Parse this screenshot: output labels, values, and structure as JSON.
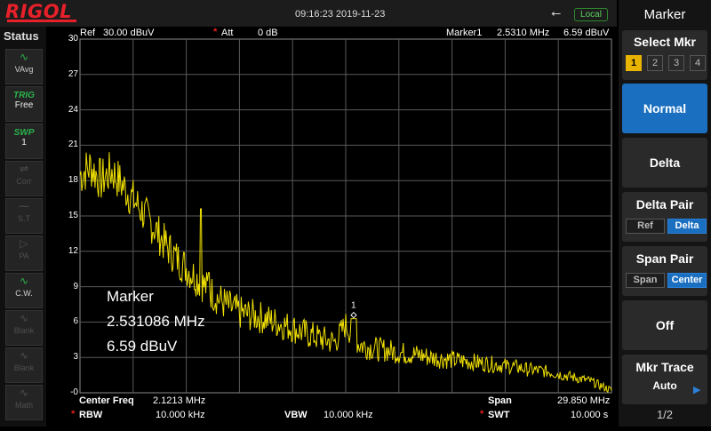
{
  "top": {
    "brand": "RIGOL",
    "datetime": "09:16:23 2019-11-23",
    "local_badge": "Local",
    "usb_icon": "usb-icon"
  },
  "status": {
    "title": "Status",
    "items": [
      {
        "name": "trace-avg",
        "icon": "wave-icon",
        "label": "VAvg",
        "state": "active"
      },
      {
        "name": "trig",
        "line1": "TRIG",
        "line2": "Free",
        "state": "text"
      },
      {
        "name": "swp",
        "line1": "SWP",
        "line2": "1",
        "state": "text"
      },
      {
        "name": "corr",
        "icon": "corr-icon",
        "label": "Corr",
        "state": "dim"
      },
      {
        "name": "st",
        "icon": "st-icon",
        "label": "S.T",
        "state": "dim"
      },
      {
        "name": "pa",
        "icon": "pa-icon",
        "label": "PA",
        "state": "dim"
      },
      {
        "name": "cw",
        "icon": "cw-icon",
        "label": "C.W.",
        "state": "active"
      },
      {
        "name": "blank1",
        "icon": "blank-icon",
        "label": "Blank",
        "state": "dim"
      },
      {
        "name": "blank2",
        "icon": "blank-icon",
        "label": "Blank",
        "state": "dim"
      },
      {
        "name": "math",
        "icon": "math-icon",
        "label": "Math",
        "state": "dim"
      }
    ]
  },
  "header": {
    "ref_label": "Ref",
    "ref_value": "30.00 dBuV",
    "att_label": "Att",
    "att_value": "0 dB",
    "marker_label": "Marker1",
    "marker_freq": "2.5310 MHz",
    "marker_level": "6.59 dBuV"
  },
  "footer": {
    "center_label": "Center Freq",
    "center_value": "2.1213 MHz",
    "span_label": "Span",
    "span_value": "29.850 MHz",
    "rbw_label": "RBW",
    "rbw_value": "10.000 kHz",
    "vbw_label": "VBW",
    "vbw_value": "10.000 kHz",
    "swt_label": "SWT",
    "swt_value": "10.000 s"
  },
  "marker_readout": {
    "title": "Marker",
    "freq": "2.531086 MHz",
    "level": "6.59 dBuV",
    "marker_id": "1"
  },
  "menu": {
    "title": "Marker",
    "select_mkr": "Select Mkr",
    "mkr_numbers": [
      "1",
      "2",
      "3",
      "4"
    ],
    "selected_mkr": "1",
    "normal": "Normal",
    "delta": "Delta",
    "delta_pair": "Delta Pair",
    "delta_pair_opts": [
      "Ref",
      "Delta"
    ],
    "span_pair": "Span Pair",
    "span_pair_opts": [
      "Span",
      "Center"
    ],
    "off": "Off",
    "mkr_trace": "Mkr Trace",
    "mkr_trace_value": "Auto",
    "page": "1/2"
  },
  "colors": {
    "trace": "#f0e000",
    "brand": "#e8202a",
    "selected": "#1a6fc0",
    "status_green": "#2bb24c"
  },
  "chart_data": {
    "type": "line",
    "y_ticks": [
      "30",
      "27",
      "24",
      "21",
      "18",
      "15",
      "12",
      "9",
      "6",
      "3",
      "-0"
    ],
    "ylim": [
      0,
      30
    ],
    "grid": true,
    "x_divisions": 10,
    "x_span_fraction": [
      0,
      1
    ],
    "series": [
      {
        "x": [
          0.0,
          0.02,
          0.04,
          0.06,
          0.08,
          0.1,
          0.12,
          0.14,
          0.16,
          0.18,
          0.2,
          0.22,
          0.24,
          0.26,
          0.28,
          0.3,
          0.32,
          0.34,
          0.36,
          0.38,
          0.4,
          0.42,
          0.44,
          0.46,
          0.48,
          0.5,
          0.52,
          0.54,
          0.56,
          0.58,
          0.6,
          0.62,
          0.64,
          0.66,
          0.68,
          0.7,
          0.72,
          0.74,
          0.76,
          0.78,
          0.8,
          0.82,
          0.84,
          0.86,
          0.88,
          0.9,
          0.92,
          0.94,
          0.96,
          0.98,
          1.0
        ],
        "values": [
          18.5,
          19.2,
          18.0,
          18.8,
          17.6,
          16.4,
          15.2,
          14.0,
          12.6,
          11.5,
          10.6,
          9.7,
          8.8,
          8.0,
          7.3,
          6.8,
          6.6,
          6.4,
          6.1,
          5.8,
          5.5,
          5.1,
          4.8,
          4.5,
          4.3,
          5.8,
          4.2,
          3.9,
          3.7,
          3.6,
          3.4,
          3.3,
          3.2,
          3.0,
          2.9,
          2.8,
          2.7,
          2.6,
          2.5,
          2.4,
          2.3,
          2.2,
          2.0,
          1.9,
          1.8,
          1.6,
          1.4,
          1.2,
          1.0,
          0.6,
          0.2
        ]
      }
    ],
    "spikes": [
      {
        "x": 0.228,
        "value": 15.6
      },
      {
        "x": 0.243,
        "value": 10.2
      }
    ],
    "marker": {
      "x": 0.515,
      "value": 6.59,
      "label": "1"
    }
  }
}
